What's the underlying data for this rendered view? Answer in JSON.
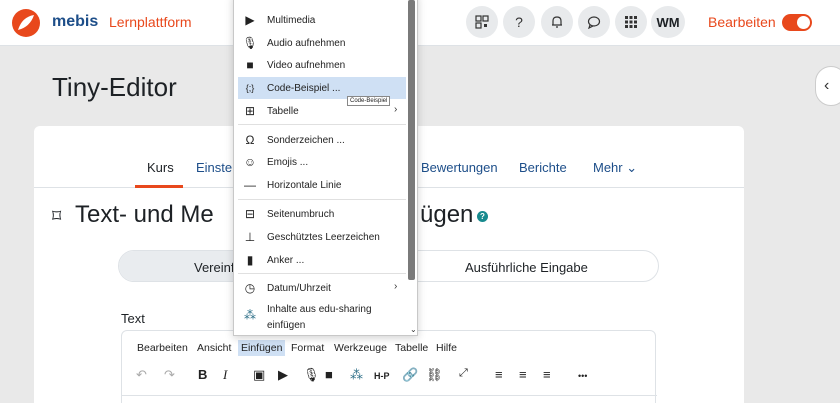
{
  "navbar": {
    "brand": "mebis",
    "platform": "Lernplattform",
    "icons": [
      "qr-code-icon",
      "help-icon",
      "bell-icon",
      "chat-icon",
      "apps-icon"
    ],
    "avatar_initials": "WM",
    "edit_label": "Bearbeiten",
    "edit_toggle_on": true
  },
  "page": {
    "title": "Tiny-Editor"
  },
  "tabs": [
    {
      "label": "Kurs",
      "active": true
    },
    {
      "label": "Einstel"
    },
    {
      "label": "Bewertungen"
    },
    {
      "label": "Berichte"
    },
    {
      "label": "Mehr ⌄"
    }
  ],
  "section": {
    "heading_left": "Text- und Me",
    "heading_right": "ügen",
    "help_icon": "?"
  },
  "segmented": {
    "left": "Vereinf",
    "right": "Ausführliche Eingabe"
  },
  "editor": {
    "label": "Text",
    "menubar": [
      "Bearbeiten",
      "Ansicht",
      "Einfügen",
      "Format",
      "Werkzeuge",
      "Tabelle",
      "Hilfe"
    ],
    "active_menu": "Einfügen",
    "toolbar": {
      "undo": "↶",
      "redo": "↷",
      "bold": "B",
      "italic": "I",
      "h5p": "H-P",
      "more": "•••"
    }
  },
  "dropdown": {
    "items": [
      {
        "label": "Multimedia",
        "icon": "media-icon"
      },
      {
        "label": "Audio aufnehmen",
        "icon": "microphone-icon"
      },
      {
        "label": "Video aufnehmen",
        "icon": "camera-icon"
      },
      {
        "label": "Code-Beispiel ...",
        "icon": "code-icon",
        "highlighted": true
      },
      {
        "label": "Tabelle",
        "icon": "table-icon",
        "submenu": true
      },
      {
        "label": "Sonderzeichen ...",
        "icon": "omega-icon"
      },
      {
        "label": "Emojis ...",
        "icon": "emoji-icon"
      },
      {
        "label": "Horizontale Linie",
        "icon": "hr-icon"
      },
      {
        "label": "Seitenumbruch",
        "icon": "pagebreak-icon"
      },
      {
        "label": "Geschütztes Leerzeichen",
        "icon": "nbsp-icon"
      },
      {
        "label": "Anker ...",
        "icon": "bookmark-icon"
      },
      {
        "label": "Datum/Uhrzeit",
        "icon": "clock-icon",
        "submenu": true
      },
      {
        "label": "Inhalte aus edu-sharing",
        "label2": "einfügen",
        "icon": "edu-sharing-icon"
      }
    ],
    "tooltip": "Code-Beispiel"
  }
}
